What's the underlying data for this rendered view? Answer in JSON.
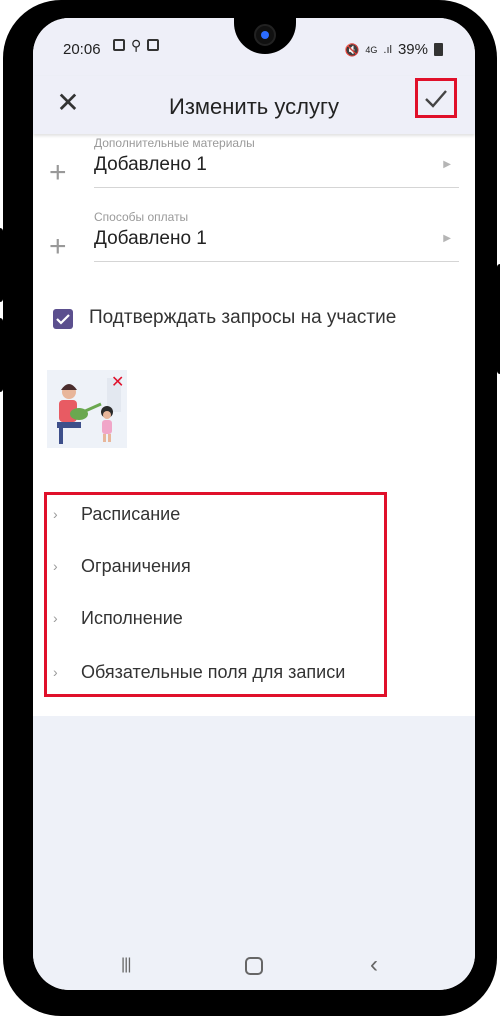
{
  "status_bar": {
    "time": "20:06",
    "network": "4G",
    "battery": "39%"
  },
  "app_bar": {
    "title": "Изменить услугу",
    "close_icon": "close-icon",
    "confirm_icon": "check-icon"
  },
  "fields": [
    {
      "label": "Дополнительные материалы",
      "value": "Добавлено 1"
    },
    {
      "label": "Способы оплаты",
      "value": "Добавлено 1"
    }
  ],
  "confirm_requests": {
    "label": "Подтверждать запросы на участие",
    "checked": true
  },
  "sections": [
    {
      "label": "Расписание"
    },
    {
      "label": "Ограничения"
    },
    {
      "label": "Исполнение"
    },
    {
      "label": "Обязательные поля для записи"
    }
  ],
  "colors": {
    "accent": "#5b4f8e",
    "highlight": "#e0102a",
    "background": "#eef1f8"
  }
}
